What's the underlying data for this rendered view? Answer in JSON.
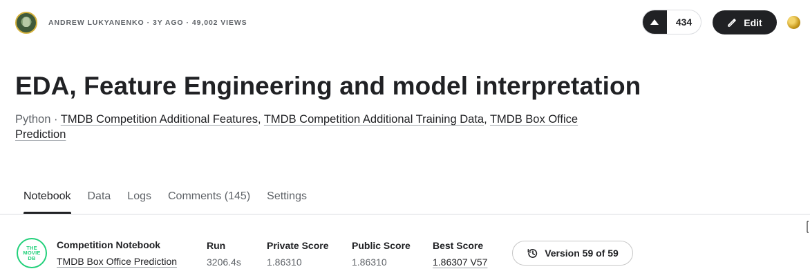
{
  "header": {
    "author": "ANDREW LUKYANENKO",
    "age": "3Y AGO",
    "views": "49,002 VIEWS",
    "separator": "·",
    "vote_count": "434",
    "edit_label": "Edit"
  },
  "notebook": {
    "title": "EDA, Feature Engineering and model interpretation",
    "language": "Python",
    "datasets": [
      "TMDB Competition Additional Features",
      "TMDB Competition Additional Training Data",
      "TMDB Box Office Prediction"
    ]
  },
  "tabs": [
    {
      "label": "Notebook",
      "active": true
    },
    {
      "label": "Data",
      "active": false
    },
    {
      "label": "Logs",
      "active": false
    },
    {
      "label": "Comments (145)",
      "active": false
    },
    {
      "label": "Settings",
      "active": false
    }
  ],
  "competition": {
    "logo_text": "THE MOVIE DB",
    "logo_color": "#21d07a",
    "label": "Competition Notebook",
    "name": "TMDB Box Office Prediction"
  },
  "stats": {
    "run_label": "Run",
    "run_value": "3206.4s",
    "private_label": "Private Score",
    "private_value": "1.86310",
    "public_label": "Public Score",
    "public_value": "1.86310",
    "best_label": "Best Score",
    "best_value": "1.86307 V57"
  },
  "version_label": "Version 59 of 59",
  "icons": {
    "upvote": "upvote-arrow-icon",
    "edit": "pencil-icon",
    "medal": "gold-medal-icon",
    "version": "history-icon"
  },
  "colors": {
    "dark": "#202124",
    "muted": "#5f6368",
    "gold": "#c89a1e",
    "tmdb_green": "#21d07a"
  }
}
